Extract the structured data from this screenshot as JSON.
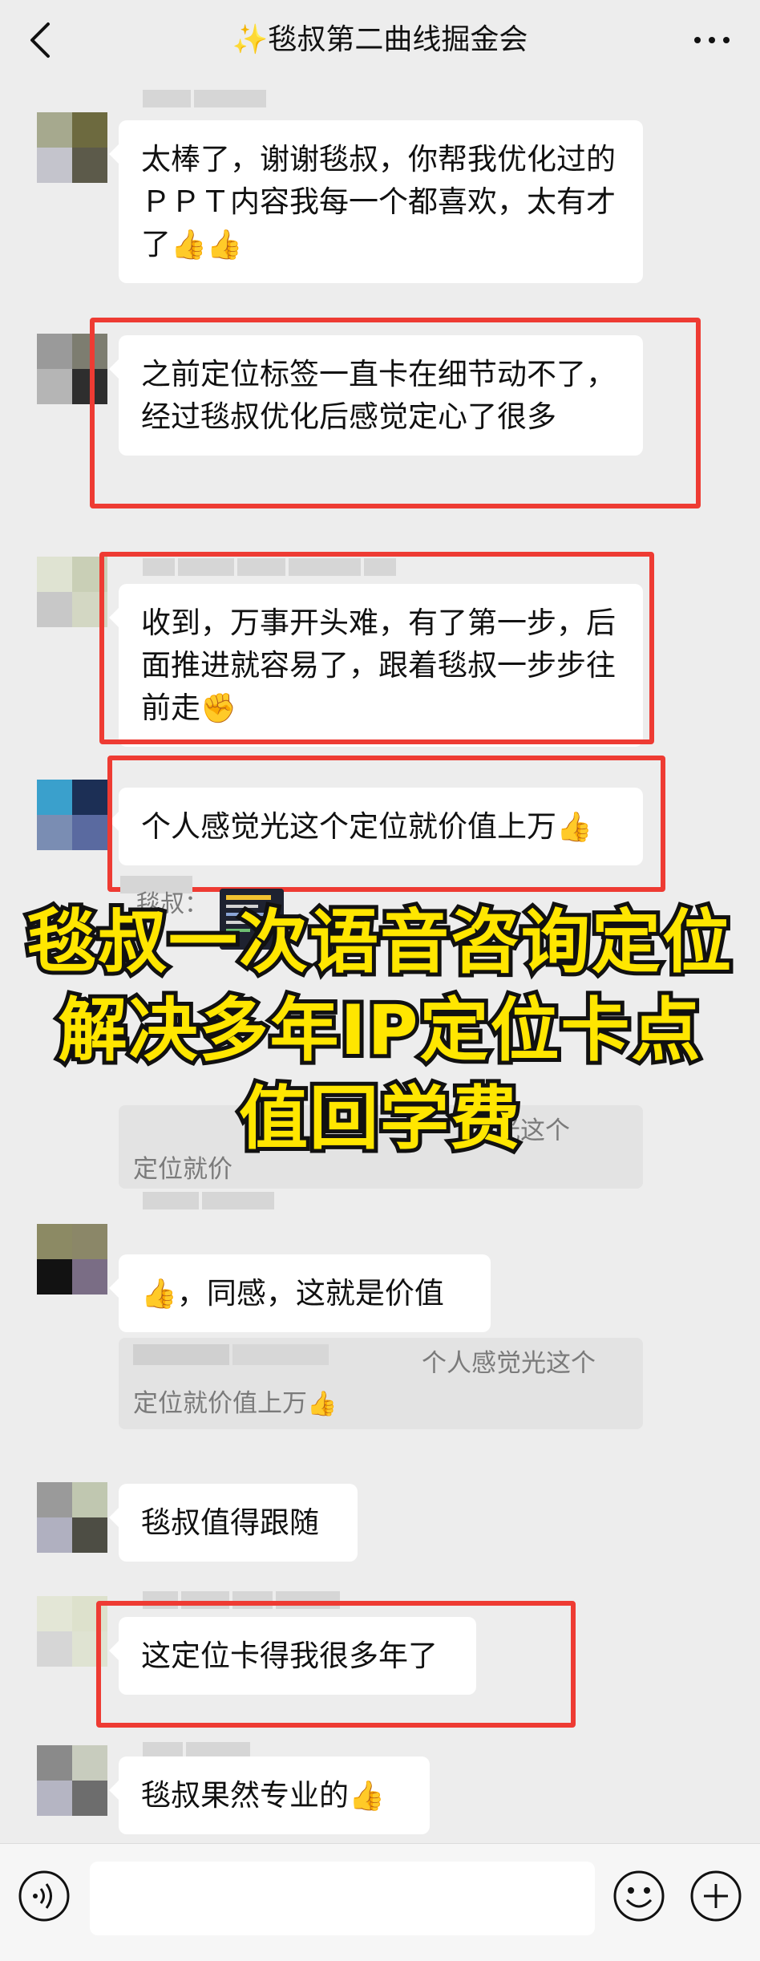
{
  "header": {
    "title": "✨毯叔第二曲线掘金会",
    "back_icon": "chevron-left-icon",
    "more_icon": "more-dots-icon"
  },
  "messages": [
    {
      "text": "太棒了，谢谢毯叔，你帮我优化过的ＰＰＴ内容我每一个都喜欢，太有才了",
      "emoji": "👍👍"
    },
    {
      "text": "之前定位标签一直卡在细节动不了，经过毯叔优化后感觉定心了很多",
      "emoji": ""
    },
    {
      "text": "收到，万事开头难，有了第一步，后面推进就容易了，跟着毯叔一步步往前走",
      "emoji": "✊"
    },
    {
      "text": "个人感觉光这个定位就价值上万",
      "emoji": "👍"
    },
    {
      "text": "，同感，这就是价值",
      "emoji": "👍"
    },
    {
      "text": "毯叔值得跟随",
      "emoji": ""
    },
    {
      "text": "这定位卡得我很多年了",
      "emoji": ""
    },
    {
      "text": "毯叔果然专业的",
      "emoji": "👍"
    }
  ],
  "reply_preview": {
    "sender": "毯叔：",
    "quote_text_line1": "光这个",
    "quote_text_line2": "定位就价",
    "quote2_line1": "个人感觉光这个",
    "quote2_line2": "定位就价值上万"
  },
  "overlay": {
    "line1": "毯叔一次语音咨询定位",
    "line2": "解决多年IP定位卡点",
    "line3": "值回学费"
  },
  "bottom": {
    "voice_icon": "voice-icon",
    "emoji_icon": "emoji-icon",
    "plus_icon": "plus-icon"
  },
  "colors": {
    "background": "#ededed",
    "bubble": "#ffffff",
    "highlight_red": "#ee3b33",
    "overlay_yellow": "#ffe600"
  }
}
